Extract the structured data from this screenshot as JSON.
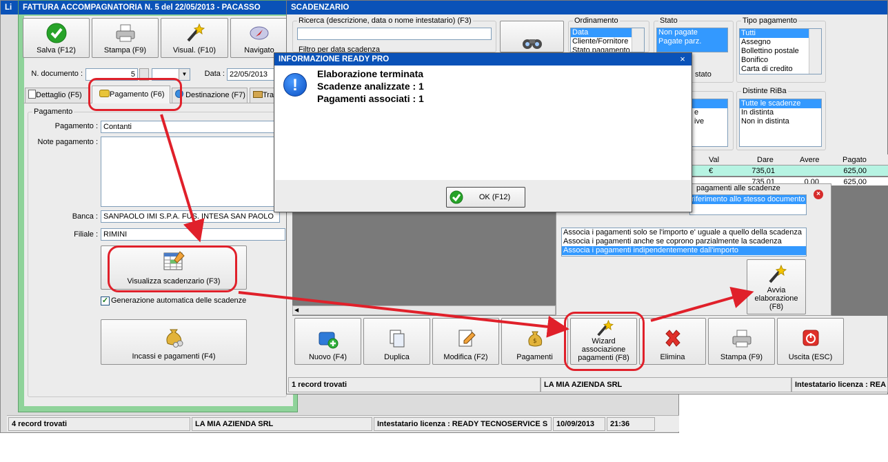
{
  "invoice_window": {
    "title": "FATTURA ACCOMPAGNATORIA N. 5 del 22/05/2013 - PACASSO",
    "list_title_fragment": "Li",
    "toolbar": {
      "save": "Salva (F12)",
      "print": "Stampa (F9)",
      "view": "Visual. (F10)",
      "navigator": "Navigato"
    },
    "doc_number_label": "N. documento :",
    "doc_number_value": "5",
    "date_label": "Data :",
    "date_value": "22/05/2013",
    "tabs": {
      "detail": "Dettaglio (F5)",
      "payment": "Pagamento (F6)",
      "destination": "Destinazione (F7)",
      "transport": "Tra"
    },
    "payment_group_title": "Pagamento",
    "payment_label": "Pagamento :",
    "payment_value": "Contanti",
    "notes_label": "Note pagamento :",
    "bank_label": "Banca :",
    "bank_value": "SANPAOLO IMI S.P.A. FUS. INTESA SAN PAOLO",
    "branch_label": "Filiale :",
    "branch_value": "RIMINI",
    "view_schedule_button": "Visualizza scadenzario (F3)",
    "auto_schedule_checkbox": "Generazione automatica delle scadenze",
    "auto_schedule_checked": true,
    "income_payments_button": "Incassi e pagamenti (F4)"
  },
  "back_status": {
    "records": "4 record trovati",
    "company": "LA MIA AZIENDA SRL",
    "license": "Intestatario licenza : READY TECNOSERVICE S",
    "date": "10/09/2013",
    "time": "21:36"
  },
  "schedule_window": {
    "title": "SCADENZARIO",
    "search_label": "Ricerca (descrizione, data o nome intestatario) (F3)",
    "search_value": "",
    "filter_label": "Filtro per data scadenza",
    "sort_group_title": "Ordinamento",
    "sort_options": [
      "Data",
      "Cliente/Fornitore",
      "Stato pagamento"
    ],
    "sort_selected": 0,
    "state_group_title": "Stato",
    "state_options": [
      "Non pagate",
      "Pagate parz."
    ],
    "state_fragment": "stato",
    "payment_type_group_title": "Tipo pagamento",
    "payment_type_options": [
      "Tutti",
      "Assegno",
      "Bollettino postale",
      "Bonifico",
      "Carta di credito"
    ],
    "payment_type_selected": 0,
    "riba_group_title": "Distinte RiBa",
    "riba_options": [
      "Tutte le scadenze",
      "In distinta",
      "Non in distinta"
    ],
    "riba_selected": 0,
    "mid_list_fragments": [
      "e",
      "ive"
    ],
    "table": {
      "headers": [
        "Val",
        "Dare",
        "Avere",
        "Pagato"
      ],
      "rows": [
        [
          "€",
          "735,01",
          "",
          "625,00"
        ],
        [
          "",
          "735,01",
          "0,00",
          "625,00"
        ]
      ]
    },
    "assoc_panel": {
      "title": "pagamenti alle scadenze",
      "top_option": "riferimento allo stesso documento",
      "options": [
        "Associa i pagamenti solo se l'importo e' uguale a quello della scadenza",
        "Associa i pagamenti anche se coprono parzialmente la scadenza",
        "Associa i pagamenti indipendentemente dall'importo"
      ],
      "selected": 2,
      "start_button_line1": "Avvia",
      "start_button_line2": "elaborazione",
      "start_button_line3": "(F8)"
    },
    "buttons": {
      "new": "Nuovo (F4)",
      "duplicate": "Duplica",
      "edit": "Modifica (F2)",
      "payments": "Pagamenti",
      "wizard_line1": "Wizard",
      "wizard_line2": "associazione",
      "wizard_line3": "pagamenti (F8)",
      "delete": "Elimina",
      "print": "Stampa (F9)",
      "exit": "Uscita (ESC)"
    },
    "status": {
      "records": "1 record trovati",
      "company": "LA MIA AZIENDA SRL",
      "license": "Intestatario licenza : REA"
    }
  },
  "dialog": {
    "title": "INFORMAZIONE READY PRO",
    "line1": "Elaborazione terminata",
    "line2": "Scadenze analizzate : 1",
    "line3": "Pagamenti associati : 1",
    "ok_button": "OK (F12)"
  },
  "colors": {
    "title_bar": "#0a52b8",
    "green_frame": "#8fd39a",
    "annotation_red": "#e0202a",
    "selection": "#3399ff",
    "grid_dark": "#7a7a7a"
  }
}
